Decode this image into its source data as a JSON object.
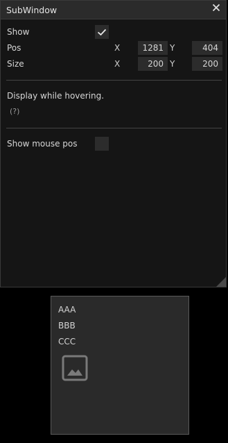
{
  "window": {
    "title": "SubWindow",
    "close_icon": "close-icon"
  },
  "rows": {
    "show": {
      "label": "Show",
      "checked": true
    },
    "pos": {
      "label": "Pos",
      "x_label": "X",
      "x_value": "1281",
      "y_label": "Y",
      "y_value": "404"
    },
    "size": {
      "label": "Size",
      "x_label": "X",
      "x_value": "200",
      "y_label": "Y",
      "y_value": "200"
    },
    "display_hover": {
      "label": "Display while hovering.",
      "help": "(?)"
    },
    "show_mouse_pos": {
      "label": "Show mouse pos",
      "checked": false
    }
  },
  "tooltip": {
    "items": [
      "AAA",
      "BBB",
      "CCC"
    ],
    "icon": "image-icon"
  }
}
